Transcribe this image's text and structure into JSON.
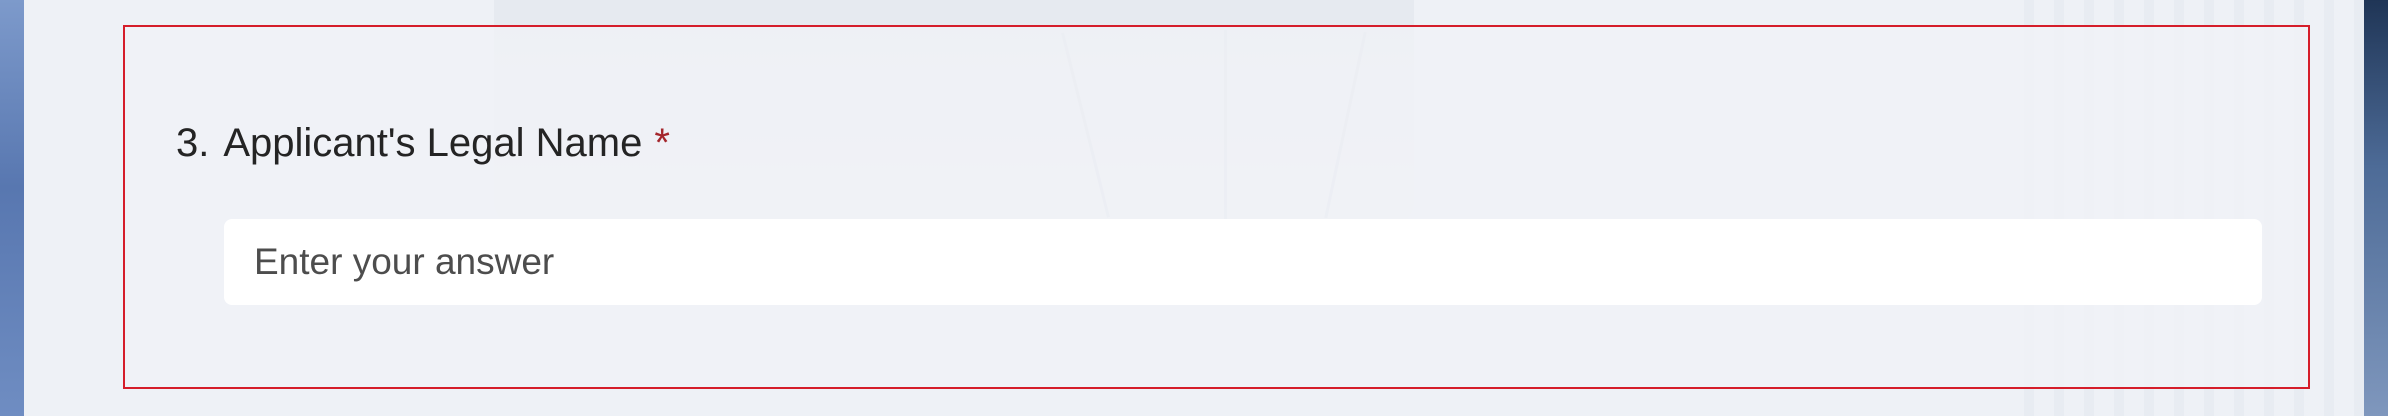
{
  "question": {
    "number": "3.",
    "title": "Applicant's Legal Name",
    "required_marker": "*",
    "required": true
  },
  "answer": {
    "value": "",
    "placeholder": "Enter your answer"
  },
  "colors": {
    "validation_border": "#d51d2a",
    "required_star": "#a4262c",
    "text": "#242424",
    "input_background": "#ffffff",
    "page_background": "#eef1f6"
  }
}
